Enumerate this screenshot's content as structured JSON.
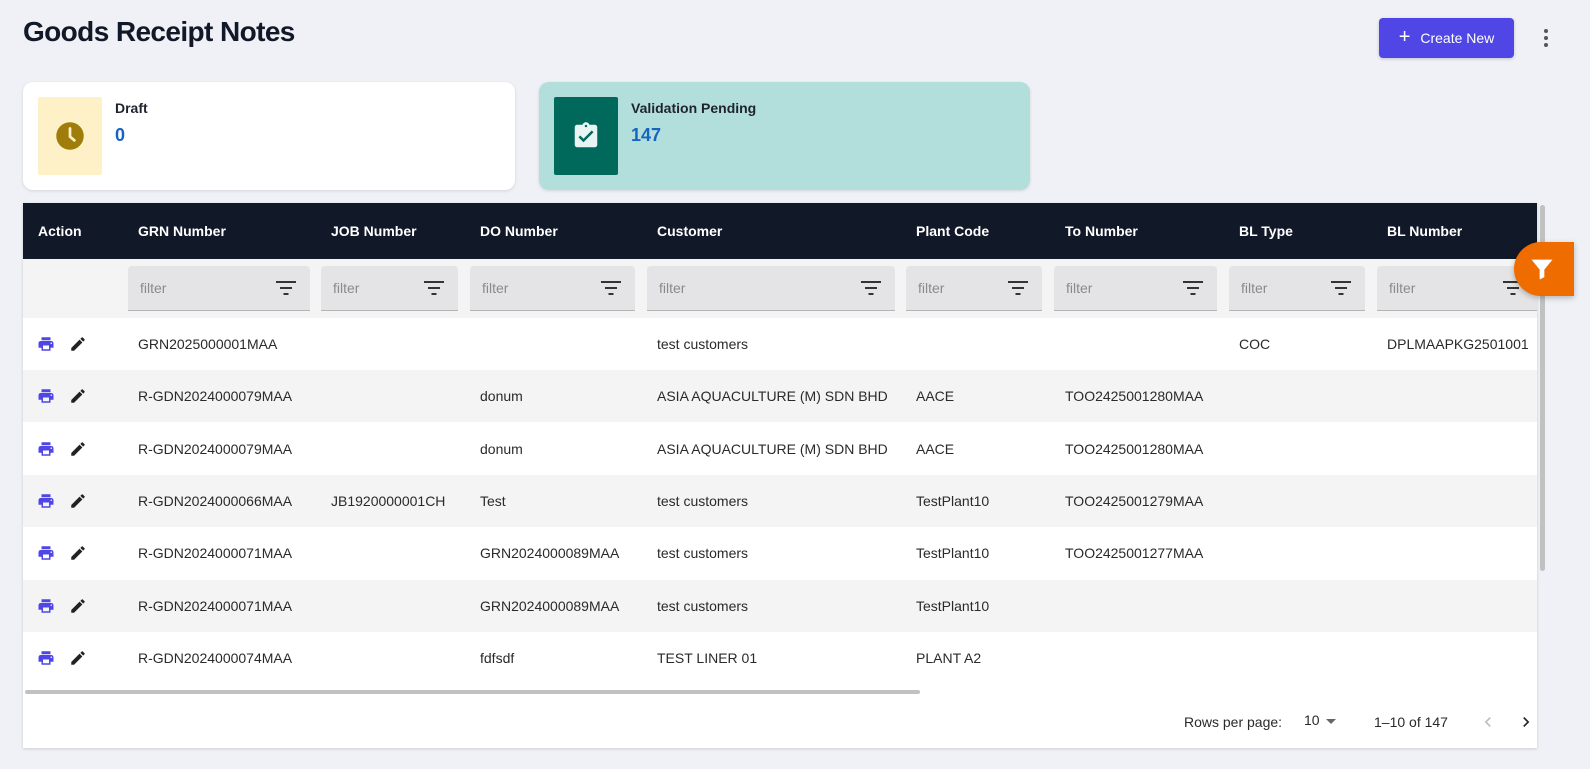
{
  "page": {
    "title": "Goods Receipt Notes"
  },
  "toolbar": {
    "create_label": "Create New"
  },
  "summary": {
    "draft": {
      "label": "Draft",
      "value": "0"
    },
    "pending": {
      "label": "Validation Pending",
      "value": "147"
    }
  },
  "table": {
    "columns": [
      "Action",
      "GRN Number",
      "JOB Number",
      "DO Number",
      "Customer",
      "Plant Code",
      "To Number",
      "BL Type",
      "BL Number"
    ],
    "filter_placeholder": "filter",
    "rows": [
      {
        "grn": "GRN2025000001MAA",
        "job": "",
        "do": "",
        "customer": "test customers",
        "plant": "",
        "to": "",
        "bl_type": "COC",
        "bl_number": "DPLMAAPKG2501001"
      },
      {
        "grn": "R-GDN2024000079MAA",
        "job": "",
        "do": "donum",
        "customer": "ASIA AQUACULTURE (M) SDN BHD",
        "plant": "AACE",
        "to": "TOO2425001280MAA",
        "bl_type": "",
        "bl_number": ""
      },
      {
        "grn": "R-GDN2024000079MAA",
        "job": "",
        "do": "donum",
        "customer": "ASIA AQUACULTURE (M) SDN BHD",
        "plant": "AACE",
        "to": "TOO2425001280MAA",
        "bl_type": "",
        "bl_number": ""
      },
      {
        "grn": "R-GDN2024000066MAA",
        "job": "JB1920000001CH",
        "do": "Test",
        "customer": "test customers",
        "plant": "TestPlant10",
        "to": "TOO2425001279MAA",
        "bl_type": "",
        "bl_number": ""
      },
      {
        "grn": "R-GDN2024000071MAA",
        "job": "",
        "do": "GRN2024000089MAA",
        "customer": "test customers",
        "plant": "TestPlant10",
        "to": "TOO2425001277MAA",
        "bl_type": "",
        "bl_number": ""
      },
      {
        "grn": "R-GDN2024000071MAA",
        "job": "",
        "do": "GRN2024000089MAA",
        "customer": "test customers",
        "plant": "TestPlant10",
        "to": "",
        "bl_type": "",
        "bl_number": ""
      },
      {
        "grn": "R-GDN2024000074MAA",
        "job": "",
        "do": "fdfsdf",
        "customer": "TEST LINER 01",
        "plant": "PLANT A2",
        "to": "",
        "bl_type": "",
        "bl_number": ""
      }
    ]
  },
  "pagination": {
    "rows_per_page_label": "Rows per page:",
    "rows_per_page_value": "10",
    "range_text": "1–10 of 147"
  },
  "colors": {
    "primary": "#4f46e5",
    "header_bg": "#111827",
    "pending_card": "#b2dfdb",
    "pending_icon": "#00695c",
    "draft_icon_bg": "#fef0c7",
    "draft_icon": "#a07d0a",
    "value_blue": "#1565c0",
    "fab": "#ef6c00"
  },
  "icons": [
    "plus-icon",
    "more-vert-icon",
    "clock-icon",
    "clipboard-check-icon",
    "filter-list-icon",
    "print-icon",
    "edit-icon",
    "funnel-icon",
    "chevron-left-icon",
    "chevron-right-icon"
  ]
}
